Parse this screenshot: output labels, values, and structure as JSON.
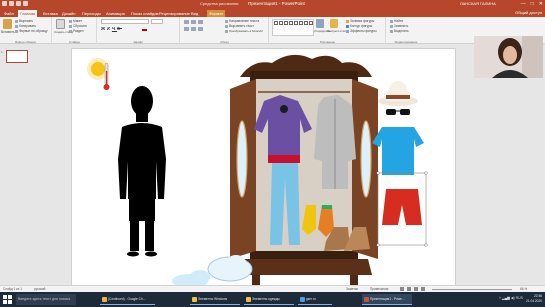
{
  "app": {
    "title": "Презентация1 - PowerPoint",
    "context_group": "Средства рисования",
    "user": "ЛАНСКАЯ ГАЛИНА",
    "controls": [
      "—",
      "□",
      "✕"
    ]
  },
  "tabs": [
    {
      "label": "Файл",
      "active": false
    },
    {
      "label": "Главная",
      "active": true
    },
    {
      "label": "Вставка",
      "active": false
    },
    {
      "label": "Дизайн",
      "active": false
    },
    {
      "label": "Переходы",
      "active": false
    },
    {
      "label": "Анимация",
      "active": false
    },
    {
      "label": "Показ слайдов",
      "active": false
    },
    {
      "label": "Рецензирование",
      "active": false
    },
    {
      "label": "Вид",
      "active": false
    },
    {
      "label": "Формат",
      "active": false,
      "contextual": true
    }
  ],
  "tabs_extra": {
    "share": "Общий доступ"
  },
  "ribbon": {
    "clipboard": {
      "paste": "Вставить",
      "cut": "Вырезать",
      "copy": "Копировать",
      "format_painter": "Формат по образцу",
      "group": "Буфер обмена"
    },
    "slides": {
      "new_slide": "Создать слайд",
      "layout": "Макет",
      "reset": "Сбросить",
      "section": "Раздел",
      "group": "Слайды"
    },
    "font": {
      "group": "Шрифт"
    },
    "paragraph": {
      "text_direction": "Направление текста",
      "align_text": "Выровнять текст",
      "smartart": "Преобразовать в SmartArt",
      "group": "Абзац"
    },
    "drawing": {
      "arrange": "Упорядочить",
      "quick_styles": "Экспресс-стили",
      "fill": "Заливка фигуры",
      "outline": "Контур фигуры",
      "effects": "Эффекты фигуры",
      "group": "Рисование"
    },
    "editing": {
      "find": "Найти",
      "replace": "Заменить",
      "select": "Выделить",
      "group": "Редактирование"
    }
  },
  "thumbnails": [
    "1"
  ],
  "status": {
    "slide": "Слайд 1 из 1",
    "lang": "русский",
    "notes": "Заметки",
    "comments": "Примечания",
    "zoom": "66 %"
  },
  "taskbar": {
    "search_placeholder": "Введите здесь текст для поиска",
    "apps": [
      {
        "label": "(Continued) - Google Ch...",
        "color": "#e9b83b"
      },
      {
        "label": "Элементы Windows",
        "color": "#f0c23c"
      },
      {
        "label": "Элементы одежды",
        "color": "#f0c23c"
      },
      {
        "label": "gsm.ru",
        "color": "#4aa0e6"
      },
      {
        "label": "Презентация1 - Powe...",
        "color": "#c5523a"
      }
    ],
    "time": "22:56",
    "date": "21.04.2020",
    "lang": "RUS"
  },
  "colors": {
    "brand": "#b7472a",
    "wardrobe": "#7a4324",
    "wardrobe_dark": "#4e2a14"
  }
}
